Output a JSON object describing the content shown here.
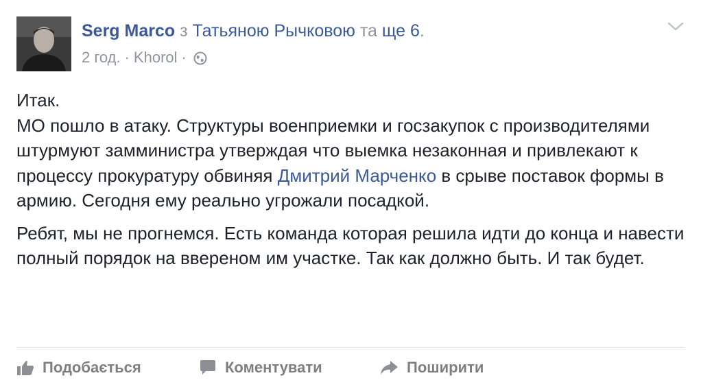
{
  "post": {
    "author": "Serg Marco",
    "with_prefix": " з ",
    "tagged": "Татьяною Рычковою",
    "and_word": " та ",
    "others": "ще 6",
    "period": ".",
    "time": "2 год.",
    "dot": "·",
    "location": "Khorol",
    "privacy_icon": "globe-icon"
  },
  "body": {
    "p1_line1": "Итак.",
    "p1_text1": "МО пошло в атаку. Структуры военприемки и госзакупок с производителями штурмуют замминистра утверждая что выемка незаконная и привлекают к процессу прокуратуру обвиняя ",
    "mention": "Дмитрий Марченко",
    "p1_text2": " в срыве поставок формы в армию. Сегодня ему реально угрожали посадкой.",
    "p2": "Ребят, мы не прогнемся. Есть команда которая решила идти до конца и навести полный порядок на ввереном им участке. Так как должно быть. И так будет."
  },
  "actions": {
    "like": "Подобається",
    "comment": "Коментувати",
    "share": "Поширити"
  },
  "colors": {
    "link": "#3b5998",
    "muted": "#90949c",
    "text": "#1d2129",
    "action": "#7f7f7f"
  }
}
